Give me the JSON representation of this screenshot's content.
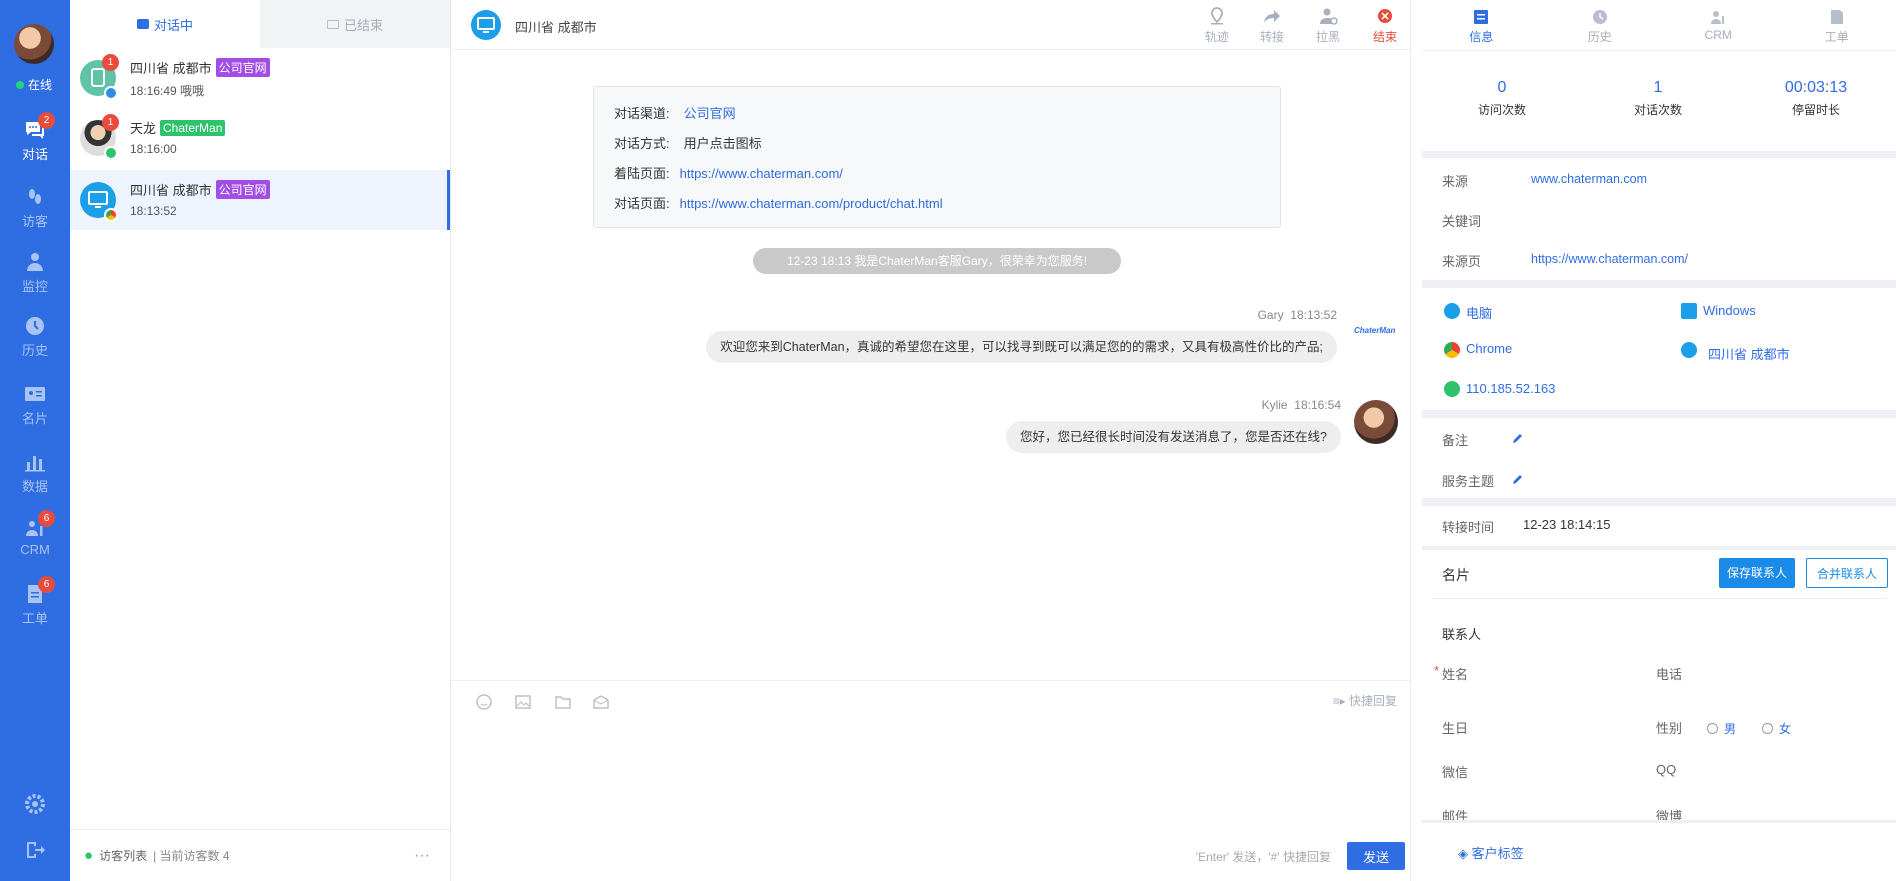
{
  "nav": {
    "status": "在线",
    "items": [
      {
        "label": "对话",
        "icon": "chat-icon",
        "badge": "2"
      },
      {
        "label": "访客",
        "icon": "footprint-icon",
        "badge": ""
      },
      {
        "label": "监控",
        "icon": "monitor-user-icon",
        "badge": ""
      },
      {
        "label": "历史",
        "icon": "clock-icon",
        "badge": ""
      },
      {
        "label": "名片",
        "icon": "card-icon",
        "badge": ""
      },
      {
        "label": "数据",
        "icon": "bar-chart-icon",
        "badge": ""
      },
      {
        "label": "CRM",
        "icon": "crm-icon",
        "badge": "6"
      },
      {
        "label": "工单",
        "icon": "ticket-icon",
        "badge": "6"
      }
    ]
  },
  "list": {
    "tab_active": "对话中",
    "tab_ended": "已结束",
    "conversations": [
      {
        "name": "四川省 成都市",
        "tag": "公司官网",
        "time": "18:16:49 哦哦",
        "badge": "1"
      },
      {
        "name": "天龙",
        "tag": "ChaterMan",
        "time": "18:16:00",
        "badge": "1"
      },
      {
        "name": "四川省 成都市",
        "tag": "公司官网",
        "time": "18:13:52",
        "badge": ""
      }
    ],
    "footer_label": "访客列表",
    "footer_count": "| 当前访客数 4",
    "more": "···"
  },
  "chat": {
    "title": "四川省 成都市",
    "actions": {
      "track": "轨迹",
      "transfer": "转接",
      "block": "拉黑",
      "end": "结束"
    },
    "info": {
      "channel_label": "对话渠道:",
      "channel_value": "公司官网",
      "method_label": "对话方式:",
      "method_value": "用户点击图标",
      "landing_label": "着陆页面:",
      "landing_value": "https://www.chaterman.com/",
      "page_label": "对话页面:",
      "page_value": "https://www.chaterman.com/product/chat.html"
    },
    "system_message": "12-23 18:13 我是ChaterMan客服Gary，很荣幸为您服务!",
    "messages": [
      {
        "sender": "Gary",
        "time": "18:13:52",
        "text": "欢迎您来到ChaterMan，真诚的希望您在这里，可以找寻到既可以满足您的的需求，又具有极高性价比的产品;",
        "avatar_text": "ChaterMan"
      },
      {
        "sender": "Kylie",
        "time": "18:16:54",
        "text": "您好，您已经很长时间没有发送消息了，您是否还在线?"
      }
    ],
    "quick_reply": "快捷回复",
    "hint": "'Enter' 发送，'#' 快捷回复",
    "send": "发送"
  },
  "right": {
    "tabs": [
      "信息",
      "历史",
      "CRM",
      "工单"
    ],
    "stats": [
      {
        "value": "0",
        "label": "访问次数"
      },
      {
        "value": "1",
        "label": "对话次数"
      },
      {
        "value": "00:03:13",
        "label": "停留时长"
      }
    ],
    "source_label": "来源",
    "source_value": "www.chaterman.com",
    "keyword_label": "关键词",
    "source_page_label": "来源页",
    "source_page_value": "https://www.chaterman.com/",
    "device": "电脑",
    "os": "Windows",
    "browser": "Chrome",
    "location": "四川省 成都市",
    "ip": "110.185.52.163",
    "remark_label": "备注",
    "topic_label": "服务主题",
    "transfer_label": "转接时间",
    "transfer_value": "12-23 18:14:15",
    "card_title": "名片",
    "save_contact": "保存联系人",
    "merge_contact": "合并联系人",
    "contact_section": "联系人",
    "name_label": "姓名",
    "phone_label": "电话",
    "birthday_label": "生日",
    "gender_label": "性别",
    "male": "男",
    "female": "女",
    "wechat_label": "微信",
    "qq_label": "QQ",
    "email_label": "邮件",
    "weibo_label": "微博",
    "customer_tag": "客户标签",
    "colors": {
      "accent": "#2f6de3",
      "danger": "#e74c3c",
      "purple_tag": "#a24ee6",
      "green_tag": "#2ec36b"
    }
  }
}
